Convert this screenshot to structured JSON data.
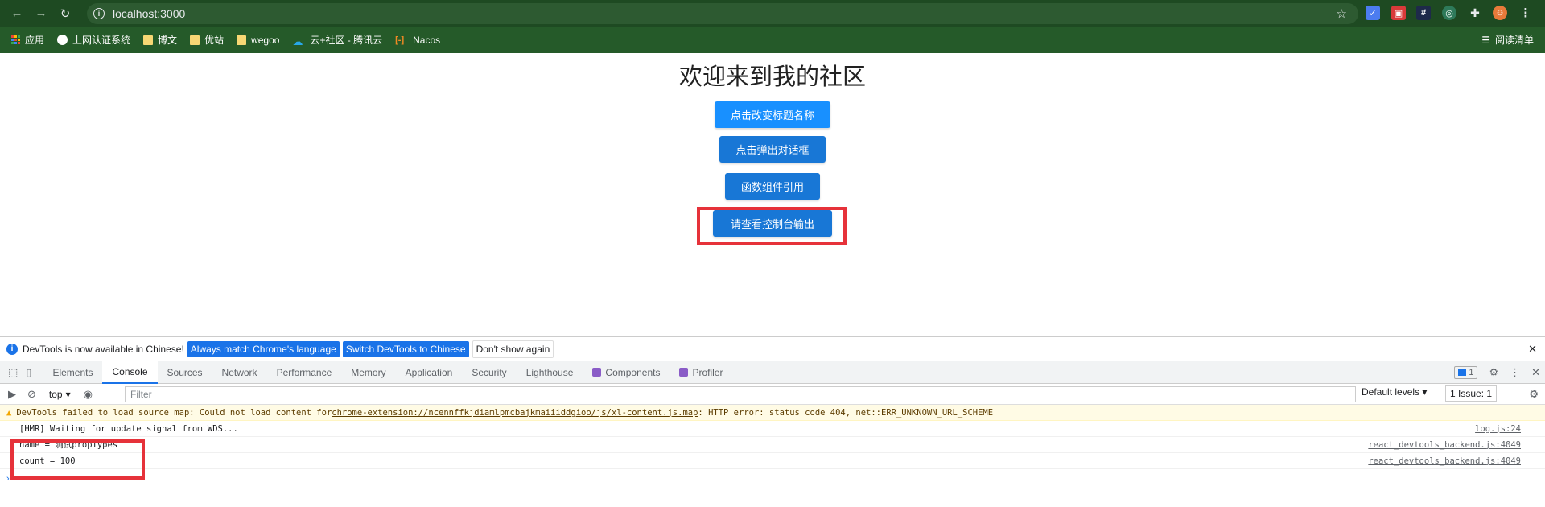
{
  "browser": {
    "url": "localhost:3000",
    "bookmarks": [
      {
        "label": "应用",
        "icon": "apps-grid-icon"
      },
      {
        "label": "上网认证系统",
        "icon": "globe-icon"
      },
      {
        "label": "博文",
        "icon": "folder-icon"
      },
      {
        "label": "优站",
        "icon": "folder-icon"
      },
      {
        "label": "wegoo",
        "icon": "folder-icon"
      },
      {
        "label": "云+社区 - 腾讯云",
        "icon": "tencent-cloud-icon"
      },
      {
        "label": "Nacos",
        "icon": "nacos-icon"
      }
    ],
    "reading_list": "阅读清单"
  },
  "page": {
    "title": "欢迎来到我的社区",
    "buttons": [
      "点击改变标题名称",
      "点击弹出对话框",
      "函数组件引用",
      "请查看控制台输出"
    ]
  },
  "devtools": {
    "infobar": {
      "message": "DevTools is now available in Chinese!",
      "btn_match": "Always match Chrome's language",
      "btn_switch": "Switch DevTools to Chinese",
      "btn_dismiss": "Don't show again"
    },
    "tabs": [
      "Elements",
      "Console",
      "Sources",
      "Network",
      "Performance",
      "Memory",
      "Application",
      "Security",
      "Lighthouse",
      "Components",
      "Profiler"
    ],
    "active_tab": "Console",
    "messages_badge": "1",
    "context": "top",
    "filter_placeholder": "Filter",
    "levels": "Default levels",
    "issues": "1 Issue:",
    "issues_count": "1",
    "warning": {
      "prefix": "DevTools failed to load source map: Could not load content for ",
      "link": "chrome-extension://ncennffkjdiamlpmcbajkmaiiiddgioo/js/xl-content.js.map",
      "suffix": ": HTTP error: status code 404, net::ERR_UNKNOWN_URL_SCHEME"
    },
    "logs": [
      {
        "text": "[HMR] Waiting for update signal from WDS...",
        "source": "log.js:24"
      },
      {
        "text": "name = 测试propTypes",
        "source": "react_devtools_backend.js:4049"
      },
      {
        "text": "count = 100",
        "source": "react_devtools_backend.js:4049"
      }
    ],
    "prompt": "›"
  },
  "colors": {
    "chrome_frame": "#1e4a22",
    "button_blue": "#1877d6",
    "highlight_red": "#e6323a"
  }
}
